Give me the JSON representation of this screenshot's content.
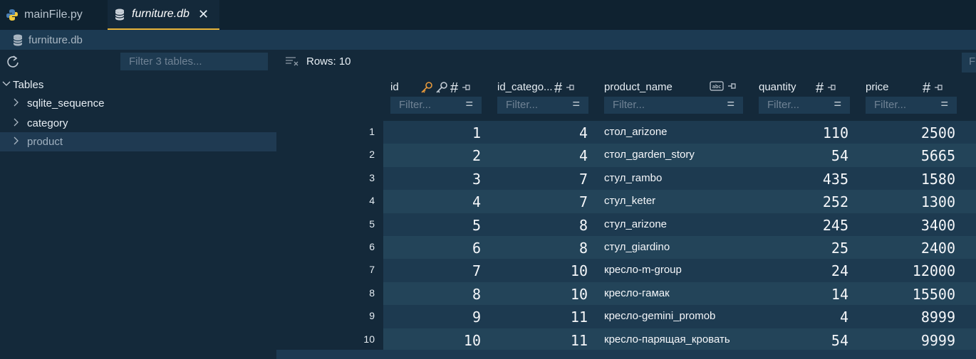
{
  "tabs": [
    {
      "label": "mainFile.py",
      "icon": "python-icon"
    },
    {
      "label": "furniture.db",
      "icon": "database-icon",
      "close": "✕"
    }
  ],
  "breadcrumb": {
    "label": "furniture.db"
  },
  "sidebar": {
    "filter_placeholder": "Filter 3 tables...",
    "root_label": "Tables",
    "items": [
      {
        "label": "sqlite_sequence"
      },
      {
        "label": "category"
      },
      {
        "label": "product"
      }
    ]
  },
  "main": {
    "rows_label": "Rows: 10",
    "right_filter_placeholder": "F",
    "filter_placeholder": "Filter...",
    "columns": [
      {
        "name": "id",
        "type_icon": "#"
      },
      {
        "name": "id_catego...",
        "type_icon": "#"
      },
      {
        "name": "product_name",
        "type_icon": "abc"
      },
      {
        "name": "quantity",
        "type_icon": "#"
      },
      {
        "name": "price",
        "type_icon": "#"
      }
    ],
    "row_numbers": [
      "1",
      "2",
      "3",
      "4",
      "5",
      "6",
      "7",
      "8",
      "9",
      "10"
    ],
    "rows": [
      {
        "id": "1",
        "id_category": "4",
        "product_name": "стол_arizone",
        "quantity": "110",
        "price": "2500"
      },
      {
        "id": "2",
        "id_category": "4",
        "product_name": "стол_garden_story",
        "quantity": "54",
        "price": "5665"
      },
      {
        "id": "3",
        "id_category": "7",
        "product_name": "стул_rambo",
        "quantity": "435",
        "price": "1580"
      },
      {
        "id": "4",
        "id_category": "7",
        "product_name": "стул_keter",
        "quantity": "252",
        "price": "1300"
      },
      {
        "id": "5",
        "id_category": "8",
        "product_name": "стул_arizone",
        "quantity": "245",
        "price": "3400"
      },
      {
        "id": "6",
        "id_category": "8",
        "product_name": "стул_giardino",
        "quantity": "25",
        "price": "2400"
      },
      {
        "id": "7",
        "id_category": "10",
        "product_name": "кресло-m-group",
        "quantity": "24",
        "price": "12000"
      },
      {
        "id": "8",
        "id_category": "10",
        "product_name": "кресло-гамак",
        "quantity": "14",
        "price": "15500"
      },
      {
        "id": "9",
        "id_category": "11",
        "product_name": "кресло-gemini_promob",
        "quantity": "4",
        "price": "8999"
      },
      {
        "id": "10",
        "id_category": "11",
        "product_name": "кресло-парящая_кровать",
        "quantity": "54",
        "price": "9999"
      }
    ]
  },
  "colors": {
    "accent": "#e8b339",
    "key_orange": "#e89a3c",
    "band_dark": "#1d3a50",
    "band_light": "#234459"
  }
}
